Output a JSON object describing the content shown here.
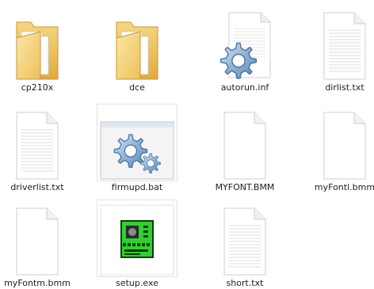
{
  "files": [
    {
      "name": "cp210x",
      "icon": "folder-icon"
    },
    {
      "name": "dce",
      "icon": "folder-icon"
    },
    {
      "name": "autorun.inf",
      "icon": "settings-file-icon"
    },
    {
      "name": "dirlist.txt",
      "icon": "text-file-icon"
    },
    {
      "name": "driverlist.txt",
      "icon": "text-file-icon"
    },
    {
      "name": "firmupd.bat",
      "icon": "batch-file-icon"
    },
    {
      "name": "MYFONT.BMM",
      "icon": "blank-file-icon"
    },
    {
      "name": "myFontl.bmm",
      "icon": "blank-file-icon"
    },
    {
      "name": "myFontm.bmm",
      "icon": "blank-file-icon"
    },
    {
      "name": "setup.exe",
      "icon": "executable-icon"
    },
    {
      "name": "short.txt",
      "icon": "text-file-icon"
    }
  ],
  "colors": {
    "folder": "#f3cf6b",
    "folder_dark": "#d9a93b",
    "exe_green": "#2fd02f",
    "gear": "#7fa8cf"
  }
}
